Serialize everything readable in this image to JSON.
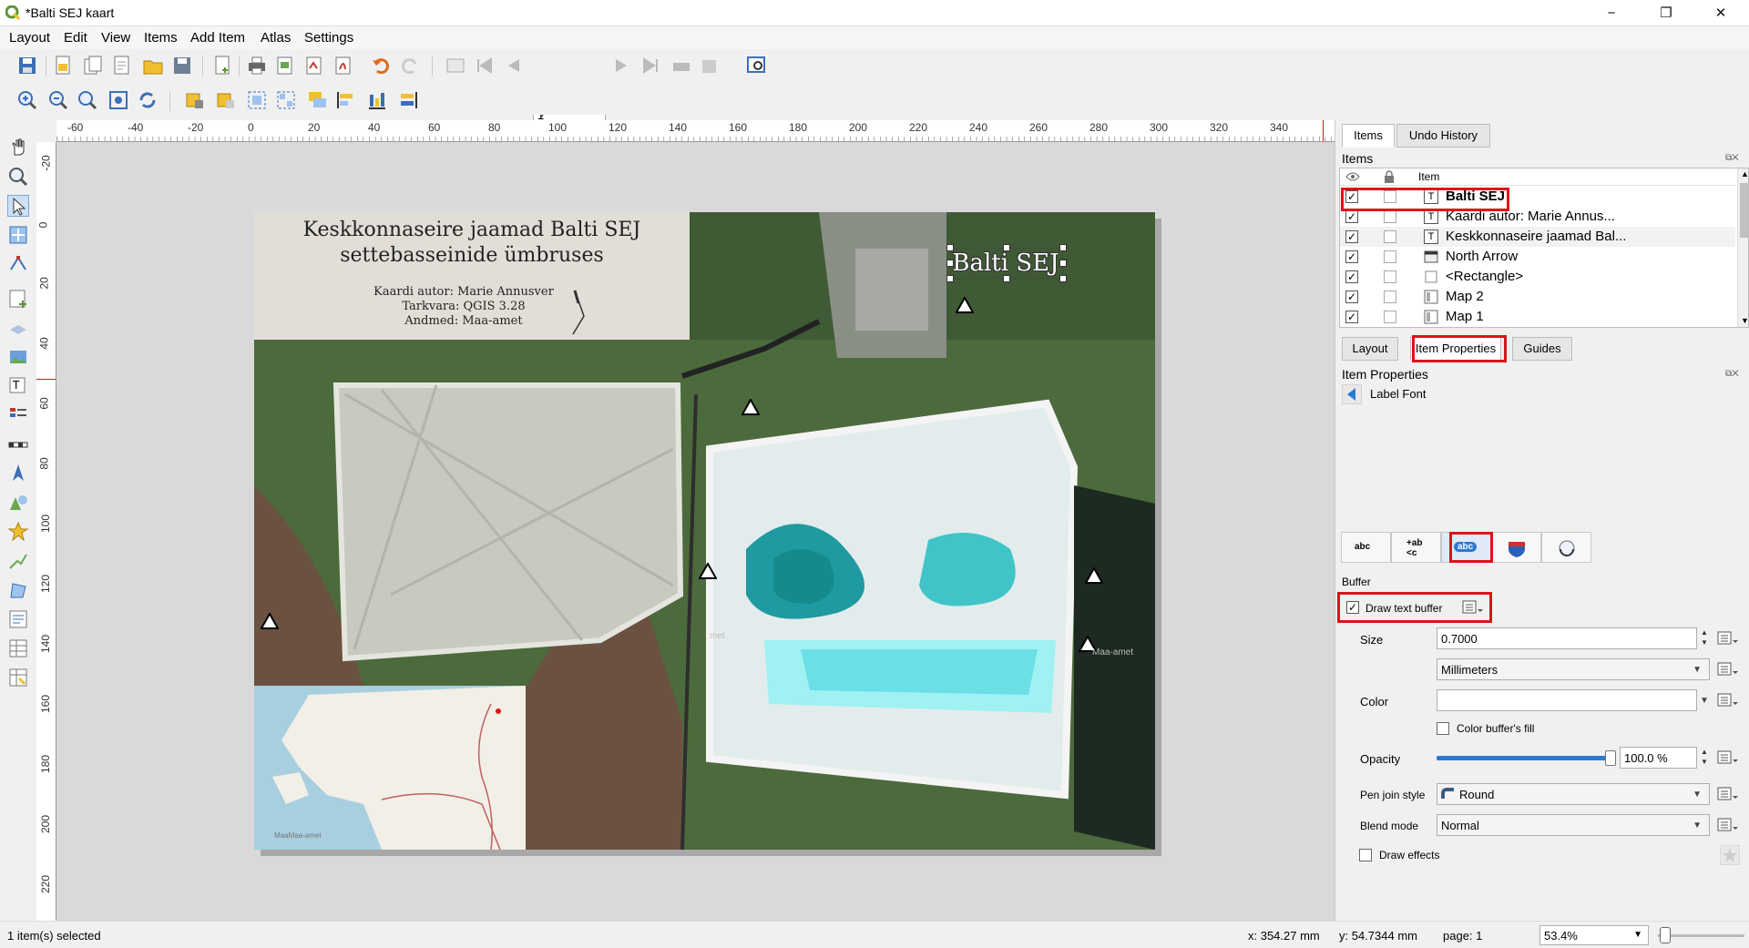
{
  "window": {
    "title": "*Balti SEJ kaart",
    "min_glyph": "−",
    "max_glyph": "❐",
    "close_glyph": "✕"
  },
  "menu": [
    "Layout",
    "Edit",
    "View",
    "Items",
    "Add Item",
    "Atlas",
    "Settings"
  ],
  "toolbar": {
    "page_value": "1"
  },
  "ruler": {
    "h_labels": [
      "-60",
      "-40",
      "-20",
      "0",
      "20",
      "40",
      "60",
      "80",
      "100",
      "120",
      "140",
      "160",
      "180",
      "200",
      "220",
      "240",
      "260",
      "280",
      "300",
      "320",
      "340"
    ],
    "v_labels": [
      "-20",
      "0",
      "20",
      "40",
      "60",
      "80",
      "100",
      "120",
      "140",
      "160",
      "180",
      "200",
      "220"
    ]
  },
  "layout_page": {
    "title": "Keskkonnaseire jaamad Balti SEJ settebasseinide ümbruses",
    "credits": [
      "Kaardi autor: Marie Annusver",
      "Tarkvara: QGIS 3.28",
      "Andmed: Maa-amet"
    ],
    "label_balti": "Balti SEJ",
    "inset_attribution": "MaaMaa-amet",
    "faint_labels": [
      "met",
      "Maa-amet"
    ]
  },
  "right_panel": {
    "tabs": [
      "Items",
      "Undo History"
    ],
    "items_title": "Items",
    "items_header": "Item",
    "items": [
      {
        "label": "Balti SEJ",
        "type_icon": "T",
        "visible": true,
        "bold": true
      },
      {
        "label": "Kaardi autor: Marie Annus...",
        "type_icon": "T",
        "visible": true
      },
      {
        "label": "Keskkonnaseire jaamad Bal...",
        "type_icon": "T",
        "visible": true
      },
      {
        "label": "North Arrow",
        "type_icon": "img",
        "visible": true
      },
      {
        "label": "<Rectangle>",
        "type_icon": "rect",
        "visible": true
      },
      {
        "label": "Map 2",
        "type_icon": "map",
        "visible": true
      },
      {
        "label": "Map 1",
        "type_icon": "map",
        "visible": true
      }
    ],
    "prop_tabs": [
      "Layout",
      "Item Properties",
      "Guides"
    ],
    "item_properties_title": "Item Properties",
    "label_font": "Label Font",
    "buffer_section": "Buffer",
    "draw_text_buffer": "Draw text buffer",
    "size_label": "Size",
    "size_value": "0.7000",
    "unit_value": "Millimeters",
    "color_label": "Color",
    "color_fill_label": "Color buffer's fill",
    "opacity_label": "Opacity",
    "opacity_value": "100.0 %",
    "opacity_level": 1.0,
    "pen_join_label": "Pen join style",
    "pen_join_value": "Round",
    "blend_label": "Blend mode",
    "blend_value": "Normal",
    "draw_effects": "Draw effects"
  },
  "status": {
    "selected": "1 item(s) selected",
    "x": "x: 354.27 mm",
    "y": "y: 54.7344 mm",
    "page": "page: 1",
    "zoom": "53.4%"
  },
  "colors": {
    "accent_red": "#e0101a",
    "qgis_green": "#589632",
    "slider_blue": "#2a7ad2"
  }
}
